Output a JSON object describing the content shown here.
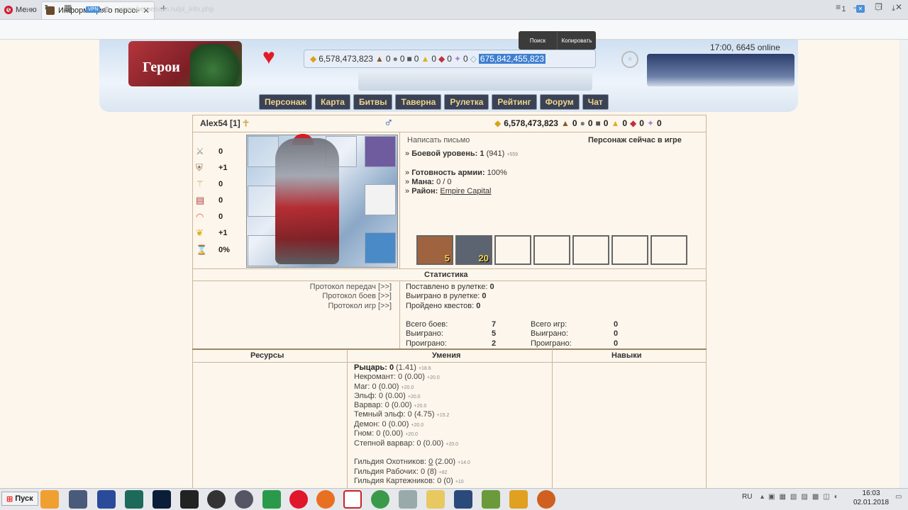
{
  "browser": {
    "menu_label": "Меню",
    "tab_title": "Информация о персонаже.",
    "tab_close": "✕",
    "new_tab": "+",
    "url": "www.heroeswm.ru/pl_info.php",
    "vpn": "VPN",
    "badge": "1"
  },
  "header": {
    "logo_text": "Герои",
    "gold": "6,578,473,823",
    "res1": "0",
    "res2": "0",
    "res3": "0",
    "res4": "0",
    "res5": "0",
    "res6": "0",
    "diamonds": "675,842,455,823",
    "context_search": "Поиск",
    "context_copy": "Копировать",
    "clock": "17:00, 6645 online"
  },
  "nav": {
    "items": [
      "Персонаж",
      "Карта",
      "Битвы",
      "Таверна",
      "Рулетка",
      "Рейтинг",
      "Форум",
      "Чат"
    ]
  },
  "character": {
    "name": "Alex54",
    "level_tag": "[1]",
    "gender_icon": "♂",
    "gold": "6,578,473,823",
    "r1": "0",
    "r2": "0",
    "r3": "0",
    "r4": "0",
    "r5": "0",
    "r6": "0",
    "stats": {
      "attack": "0",
      "defense": "+1",
      "spellpower": "0",
      "knowledge": "0",
      "luck": "0",
      "morale": "+1",
      "exp": "0%"
    },
    "write_letter": "Написать письмо",
    "online_status": "Персонаж сейчас в игре",
    "combat_level_label": "Боевой уровень:",
    "combat_level": "1",
    "combat_level_extra": "(941)",
    "combat_level_next": "+559",
    "army_ready_label": "Готовность армии:",
    "army_ready": "100%",
    "mana_label": "Мана:",
    "mana": "0 / 0",
    "district_label": "Район:",
    "district": "Empire Capital",
    "army": [
      {
        "count": "5",
        "color": "#a0633f"
      },
      {
        "count": "20",
        "color": "#5b6470"
      }
    ]
  },
  "statistics": {
    "title": "Статистика",
    "protocols": [
      "Протокол передач [>>]",
      "Протокол боев [>>]",
      "Протокол игр [>>]"
    ],
    "roulette_bet_label": "Поставлено в рулетке:",
    "roulette_bet": "0",
    "roulette_won_label": "Выиграно в рулетке:",
    "roulette_won": "0",
    "quests_label": "Пройдено квестов:",
    "quests": "0",
    "battles_total_label": "Всего боев:",
    "battles_total": "7",
    "battles_won_label": "Выиграно:",
    "battles_won": "5",
    "battles_lost_label": "Проиграно:",
    "battles_lost": "2",
    "games_total_label": "Всего игр:",
    "games_total": "0",
    "games_won_label": "Выиграно:",
    "games_won": "0",
    "games_lost_label": "Проиграно:",
    "games_lost": "0"
  },
  "sections": {
    "resources": "Ресурсы",
    "skills": "Умения",
    "abilities": "Навыки"
  },
  "skills": [
    {
      "name": "Рыцарь:",
      "value": "0",
      "extra": "(1.41)",
      "next": "+18.6",
      "bold": true
    },
    {
      "name": "Некромант:",
      "value": "0",
      "extra": "(0.00)",
      "next": "+20.0"
    },
    {
      "name": "Маг:",
      "value": "0",
      "extra": "(0.00)",
      "next": "+20.0"
    },
    {
      "name": "Эльф:",
      "value": "0",
      "extra": "(0.00)",
      "next": "+20.0"
    },
    {
      "name": "Варвар:",
      "value": "0",
      "extra": "(0.00)",
      "next": "+20.0"
    },
    {
      "name": "Темный эльф:",
      "value": "0",
      "extra": "(4.75)",
      "next": "+15.2"
    },
    {
      "name": "Демон:",
      "value": "0",
      "extra": "(0.00)",
      "next": "+20.0"
    },
    {
      "name": "Гном:",
      "value": "0",
      "extra": "(0.00)",
      "next": "+20.0"
    },
    {
      "name": "Степной варвар:",
      "value": "0",
      "extra": "(0.00)",
      "next": "+20.0"
    }
  ],
  "guilds": [
    {
      "name": "Гильдия Охотников:",
      "value": "0",
      "extra": "(2.00)",
      "next": "+14.0"
    },
    {
      "name": "Гильдия Рабочих:",
      "value": "0",
      "extra": "(8)",
      "next": "+82"
    },
    {
      "name": "Гильдия Картежников:",
      "value": "0",
      "extra": "(0)",
      "next": "+10"
    }
  ],
  "taskbar": {
    "start": "Пуск",
    "lang": "RU",
    "time": "16:03",
    "date": "02.01.2018"
  }
}
